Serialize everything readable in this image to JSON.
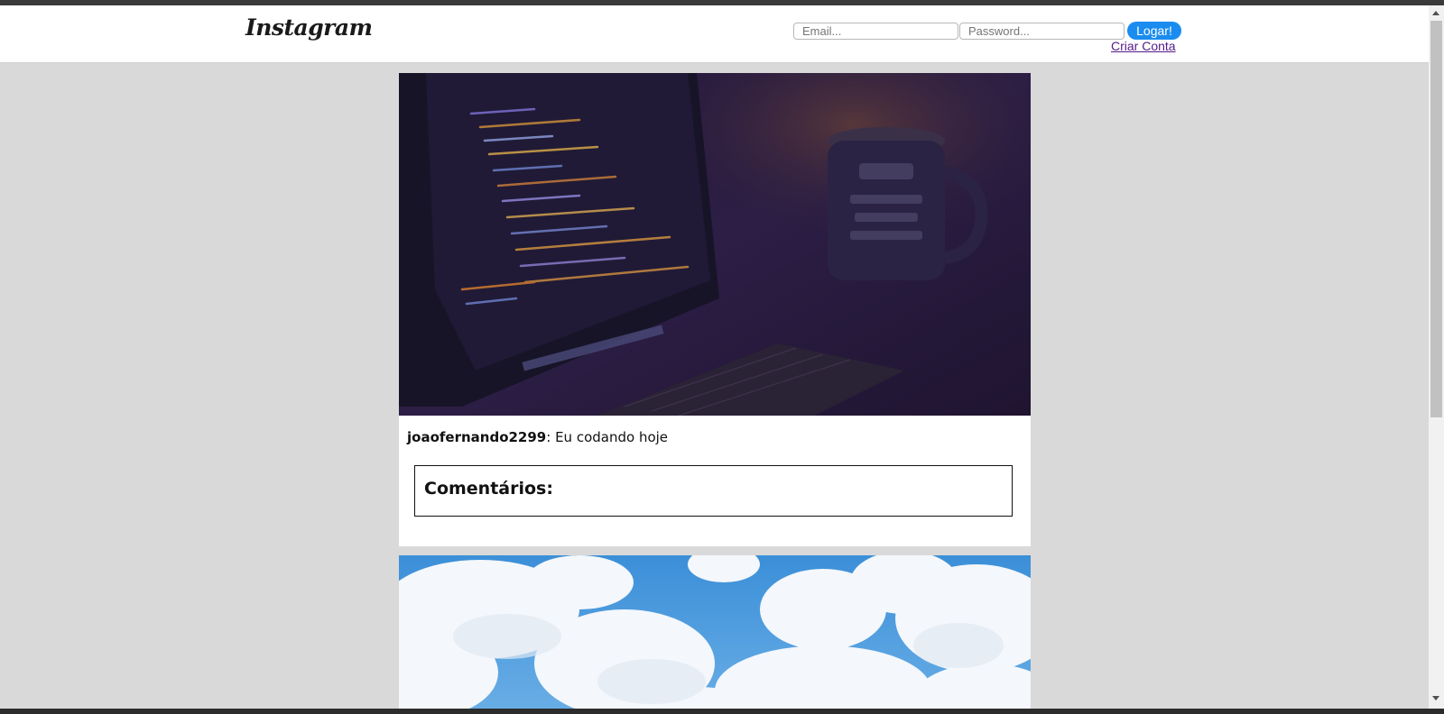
{
  "header": {
    "logo": "Instagram",
    "email_placeholder": "Email...",
    "password_placeholder": "Password...",
    "login_label": "Logar!",
    "create_account_label": "Criar Conta"
  },
  "posts": [
    {
      "username": "joaofernando2299",
      "separator": ":",
      "caption": " Eu codando hoje",
      "comments_title": "Comentários:",
      "image_icon": "laptop-code-photo"
    },
    {
      "image_icon": "blue-sky-clouds-photo"
    }
  ],
  "colors": {
    "page_background": "#d9d9d9",
    "login_button": "#1a8cf0",
    "link_visited": "#551a8b"
  }
}
